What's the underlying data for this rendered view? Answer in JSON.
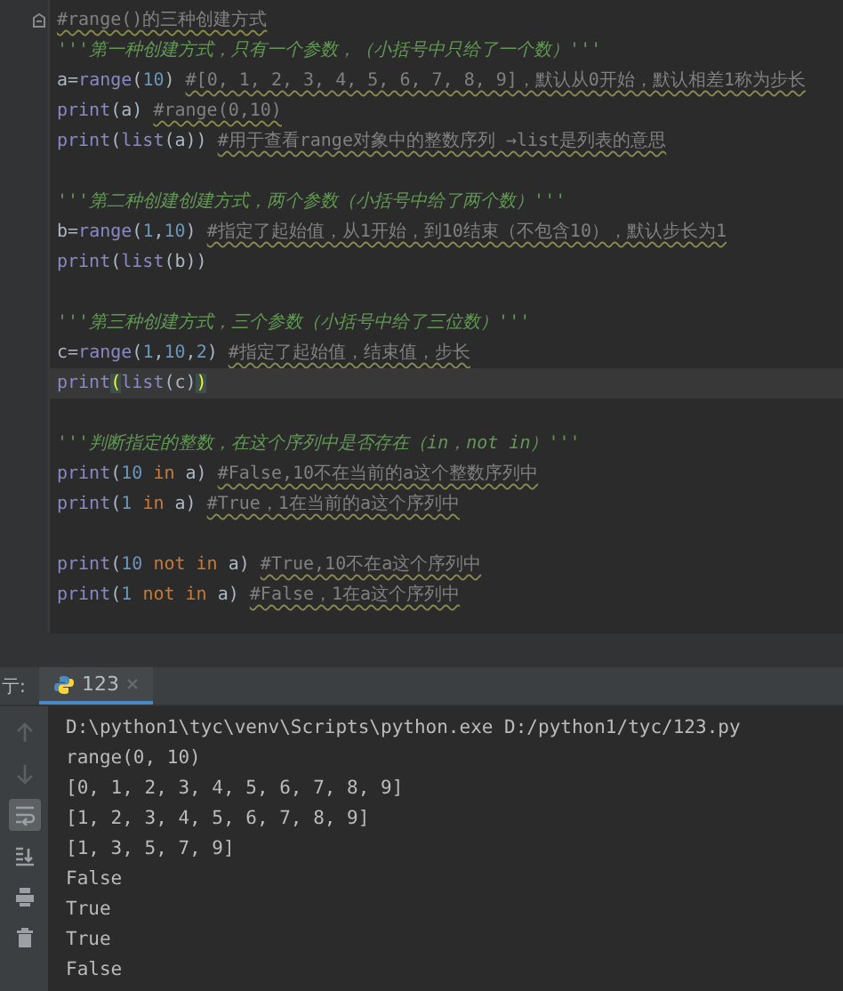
{
  "editor": {
    "blocks": [
      {
        "lines": [
          {
            "fold": true,
            "tokens": [
              {
                "text": "#range()的三种创建方式",
                "kind": "comment"
              }
            ]
          },
          {
            "tokens": [
              {
                "text": "'''第一种创建方式，只有一个参数，（小括号中只给了一个数）'''",
                "kind": "doc"
              }
            ]
          },
          {
            "tokens": [
              {
                "text": "a=",
                "kind": "plain"
              },
              {
                "text": "range",
                "kind": "builtin"
              },
              {
                "text": "(",
                "kind": "plain"
              },
              {
                "text": "10",
                "kind": "num"
              },
              {
                "text": ") ",
                "kind": "plain"
              },
              {
                "text": "#[0, 1, 2, 3, 4, 5, 6, 7, 8, 9]，默认从0开始，默认相差1称为步长",
                "kind": "comment"
              }
            ]
          },
          {
            "tokens": [
              {
                "text": "print",
                "kind": "builtin"
              },
              {
                "text": "(a) ",
                "kind": "plain"
              },
              {
                "text": "#range(0,10)",
                "kind": "comment"
              }
            ]
          },
          {
            "tokens": [
              {
                "text": "print",
                "kind": "builtin"
              },
              {
                "text": "(",
                "kind": "plain"
              },
              {
                "text": "list",
                "kind": "builtin"
              },
              {
                "text": "(a)) ",
                "kind": "plain"
              },
              {
                "text": "#用于查看range对象中的整数序列 →list是列表的意思",
                "kind": "comment"
              }
            ]
          }
        ]
      },
      {
        "lines": [
          {
            "tokens": [
              {
                "text": "'''第二种创建创建方式，两个参数（小括号中给了两个数）'''",
                "kind": "doc"
              }
            ]
          },
          {
            "tokens": [
              {
                "text": "b=",
                "kind": "plain"
              },
              {
                "text": "range",
                "kind": "builtin"
              },
              {
                "text": "(",
                "kind": "plain"
              },
              {
                "text": "1",
                "kind": "num"
              },
              {
                "text": ",",
                "kind": "plain"
              },
              {
                "text": "10",
                "kind": "num"
              },
              {
                "text": ") ",
                "kind": "plain"
              },
              {
                "text": "#指定了起始值，从1开始，到10结束（不包含10），默认步长为1",
                "kind": "comment"
              }
            ]
          },
          {
            "tokens": [
              {
                "text": "print",
                "kind": "builtin"
              },
              {
                "text": "(",
                "kind": "plain"
              },
              {
                "text": "list",
                "kind": "builtin"
              },
              {
                "text": "(b))",
                "kind": "plain"
              }
            ]
          }
        ]
      },
      {
        "lines": [
          {
            "tokens": [
              {
                "text": "'''第三种创建方式，三个参数（小括号中给了三位数）'''",
                "kind": "doc"
              }
            ]
          },
          {
            "tokens": [
              {
                "text": "c=",
                "kind": "plain"
              },
              {
                "text": "range",
                "kind": "builtin"
              },
              {
                "text": "(",
                "kind": "plain"
              },
              {
                "text": "1",
                "kind": "num"
              },
              {
                "text": ",",
                "kind": "plain"
              },
              {
                "text": "10",
                "kind": "num"
              },
              {
                "text": ",",
                "kind": "plain"
              },
              {
                "text": "2",
                "kind": "num"
              },
              {
                "text": ") ",
                "kind": "plain"
              },
              {
                "text": "#指定了起始值，结束值，步长",
                "kind": "comment"
              }
            ]
          },
          {
            "current": true,
            "tokens": [
              {
                "text": "print",
                "kind": "builtin"
              },
              {
                "text": "(",
                "kind": "match"
              },
              {
                "text": "list",
                "kind": "builtin"
              },
              {
                "text": "(c)",
                "kind": "plain"
              },
              {
                "text": ")",
                "kind": "match"
              }
            ]
          }
        ]
      },
      {
        "lines": [
          {
            "tokens": [
              {
                "text": "'''判断指定的整数，在这个序列中是否存在（in，not in）'''",
                "kind": "doc"
              }
            ]
          },
          {
            "tokens": [
              {
                "text": "print",
                "kind": "builtin"
              },
              {
                "text": "(",
                "kind": "plain"
              },
              {
                "text": "10",
                "kind": "num"
              },
              {
                "text": " in ",
                "kind": "kw"
              },
              {
                "text": "a) ",
                "kind": "plain"
              },
              {
                "text": "#False,10不在当前的a这个整数序列中",
                "kind": "comment"
              }
            ]
          },
          {
            "tokens": [
              {
                "text": "print",
                "kind": "builtin"
              },
              {
                "text": "(",
                "kind": "plain"
              },
              {
                "text": "1",
                "kind": "num"
              },
              {
                "text": " in ",
                "kind": "kw"
              },
              {
                "text": "a) ",
                "kind": "plain"
              },
              {
                "text": "#True，1在当前的a这个序列中",
                "kind": "comment"
              }
            ]
          }
        ]
      },
      {
        "lines": [
          {
            "tokens": [
              {
                "text": "print",
                "kind": "builtin"
              },
              {
                "text": "(",
                "kind": "plain"
              },
              {
                "text": "10",
                "kind": "num"
              },
              {
                "text": " not in ",
                "kind": "kw"
              },
              {
                "text": "a) ",
                "kind": "plain"
              },
              {
                "text": "#True,10不在a这个序列中",
                "kind": "comment"
              }
            ]
          },
          {
            "tokens": [
              {
                "text": "print",
                "kind": "builtin"
              },
              {
                "text": "(",
                "kind": "plain"
              },
              {
                "text": "1",
                "kind": "num"
              },
              {
                "text": " not in ",
                "kind": "kw"
              },
              {
                "text": "a) ",
                "kind": "plain"
              },
              {
                "text": "#False，1在a这个序列中",
                "kind": "comment"
              }
            ]
          }
        ]
      }
    ]
  },
  "run_panel": {
    "label": "亍:",
    "tabs": [
      {
        "label": "123",
        "selected": true
      }
    ],
    "tools": [
      {
        "kind": "up",
        "selected": false
      },
      {
        "kind": "down",
        "selected": false
      },
      {
        "kind": "wrap",
        "selected": true
      },
      {
        "kind": "scroll",
        "selected": false
      },
      {
        "kind": "print",
        "selected": false
      },
      {
        "kind": "trash",
        "selected": false
      }
    ],
    "output": [
      "D:\\python1\\tyc\\venv\\Scripts\\python.exe D:/python1/tyc/123.py",
      "range(0, 10)",
      "[0, 1, 2, 3, 4, 5, 6, 7, 8, 9]",
      "[1, 2, 3, 4, 5, 6, 7, 8, 9]",
      "[1, 3, 5, 7, 9]",
      "False",
      "True",
      "True",
      "False"
    ]
  }
}
